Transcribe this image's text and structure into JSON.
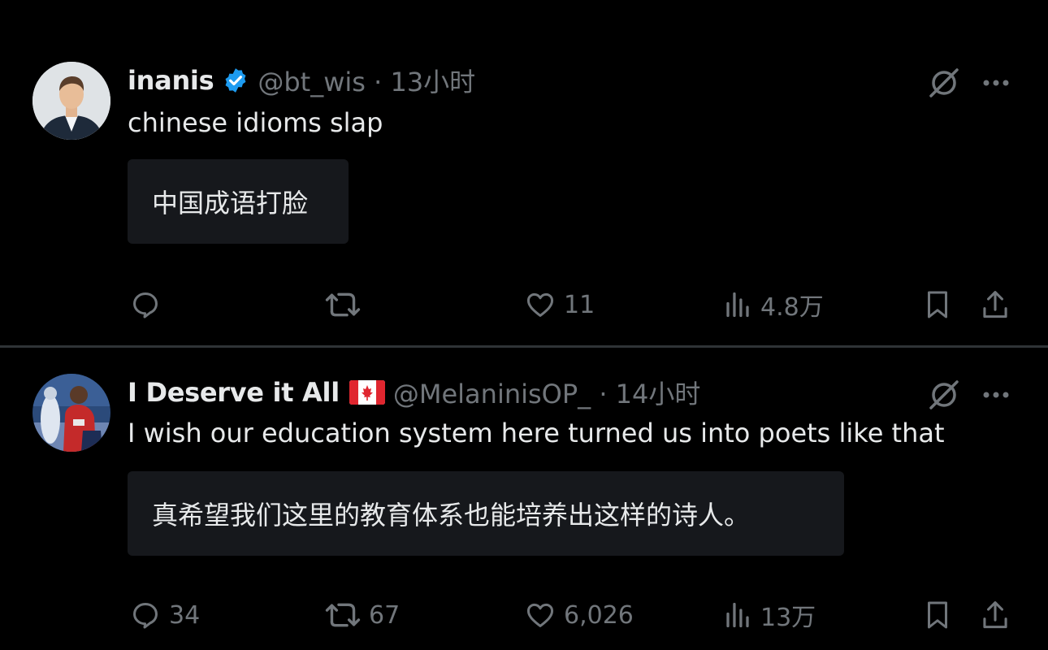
{
  "colors": {
    "background": "#000000",
    "text_primary": "#e7e9ea",
    "text_secondary": "#71767b",
    "verified": "#1d9bf0",
    "translation_box": "#16181c"
  },
  "tweets": [
    {
      "display_name": "inanis",
      "badge": "verified-icon",
      "handle": "@bt_wis",
      "separator": "·",
      "time": "13小时",
      "text": "chinese idioms slap",
      "translation": "中国成语打脸",
      "actions": {
        "replies": "",
        "reposts": "",
        "likes": "11",
        "views": "4.8万"
      }
    },
    {
      "display_name": "I Deserve it All",
      "badge": "canada-flag-icon",
      "handle": "@MelaninisOP_",
      "separator": "·",
      "time": "14小时",
      "text": "I wish our education system here turned us into poets like that",
      "translation": "真希望我们这里的教育体系也能培养出这样的诗人。",
      "actions": {
        "replies": "34",
        "reposts": "67",
        "likes": "6,026",
        "views": "13万"
      }
    }
  ]
}
